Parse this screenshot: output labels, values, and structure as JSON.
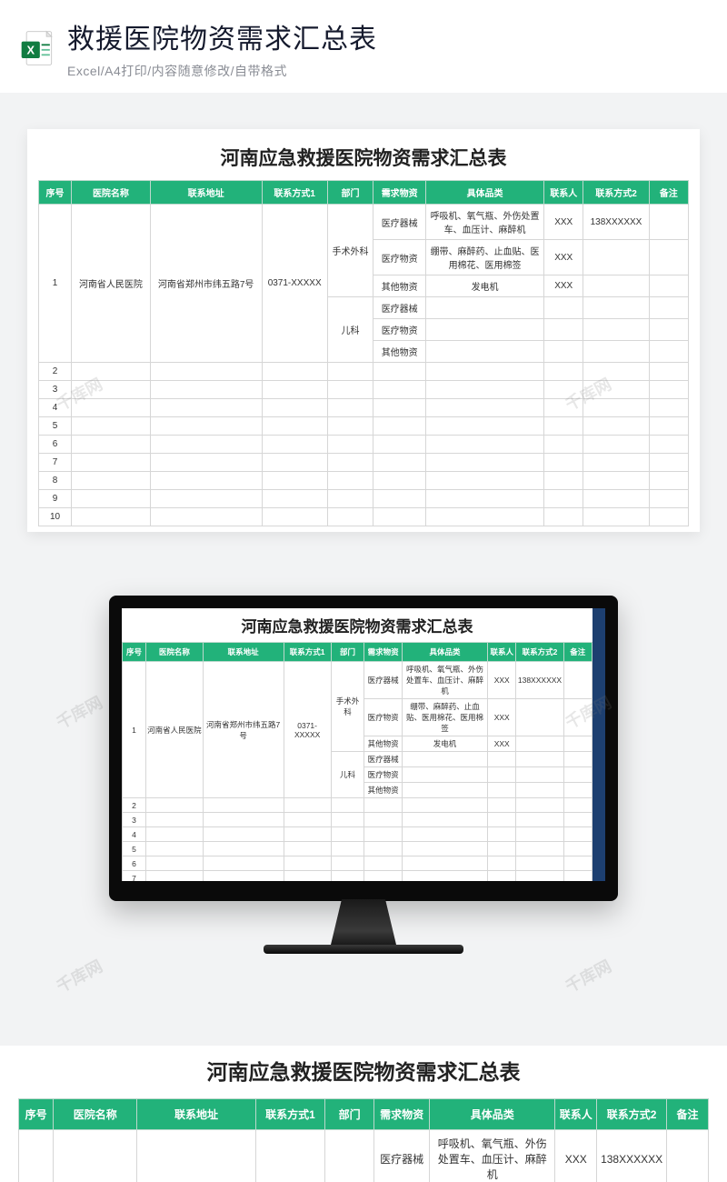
{
  "header": {
    "title": "救援医院物资需求汇总表",
    "subtitle": "Excel/A4打印/内容随意修改/自带格式"
  },
  "sheet": {
    "title": "河南应急救援医院物资需求汇总表",
    "columns": [
      "序号",
      "医院名称",
      "联系地址",
      "联系方式1",
      "部门",
      "需求物资",
      "具体品类",
      "联系人",
      "联系方式2",
      "备注"
    ],
    "row1": {
      "seq": "1",
      "hospital": "河南省人民医院",
      "address": "河南省郑州市纬五路7号",
      "phone1": "0371-XXXXX",
      "dept_a": "手术外科",
      "dept_b": "儿科",
      "supply_a1": "医疗器械",
      "category_a1": "呼吸机、氧气瓶、外伤处置车、血压计、麻醉机",
      "contact_a1": "XXX",
      "phone2_a1": "138XXXXXX",
      "supply_a2": "医疗物资",
      "category_a2": "绷带、麻醉药、止血贴、医用棉花、医用棉签",
      "contact_a2": "XXX",
      "supply_a3": "其他物资",
      "category_a3": "发电机",
      "contact_a3": "XXX",
      "supply_b1": "医疗器械",
      "supply_b2": "医疗物资",
      "supply_b3": "其他物资"
    },
    "empty_seqs": [
      "2",
      "3",
      "4",
      "5",
      "6",
      "7",
      "8",
      "9",
      "10"
    ]
  },
  "watermark": "千库网"
}
